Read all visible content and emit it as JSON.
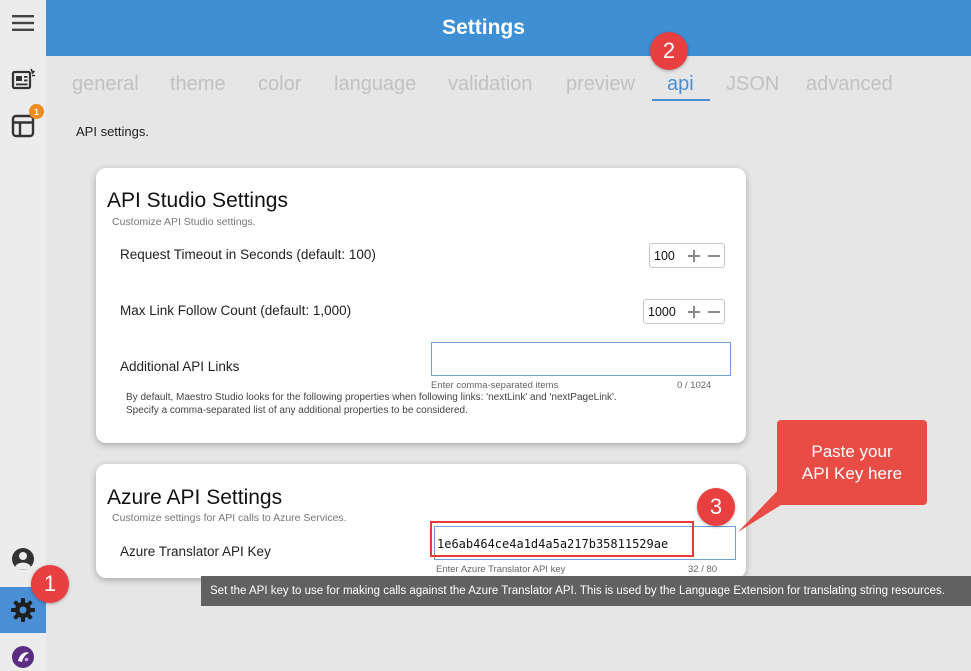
{
  "header": {
    "title": "Settings"
  },
  "rail": {
    "menu_icon": "hamburger-menu-icon",
    "news_icon": "news-icon",
    "panels_icon": "panels-icon",
    "panels_badge": "1",
    "account_icon": "account-icon",
    "settings_icon": "gear-icon",
    "logo_icon": "app-logo-icon",
    "accent_color": "#4a8fd6"
  },
  "tabs": [
    {
      "label": "general"
    },
    {
      "label": "theme"
    },
    {
      "label": "color"
    },
    {
      "label": "language"
    },
    {
      "label": "validation"
    },
    {
      "label": "preview"
    },
    {
      "label": "api"
    },
    {
      "label": "JSON"
    },
    {
      "label": "advanced"
    }
  ],
  "active_tab": "api",
  "intro": "API settings.",
  "api_studio": {
    "title": "API Studio Settings",
    "subtitle": "Customize API Studio settings.",
    "timeout": {
      "label": "Request Timeout in Seconds (default: 100)",
      "value": "100"
    },
    "max_link": {
      "label": "Max Link Follow Count (default: 1,000)",
      "value": "1000"
    },
    "additional_links": {
      "label": "Additional API Links",
      "value": "",
      "hint": "Enter comma-separated items",
      "counter": "0 / 1024",
      "help_line1": "By default, Maestro Studio looks for the following properties when following links: 'nextLink' and 'nextPageLink'.",
      "help_line2": "Specify a comma-separated list of any additional properties to be considered."
    }
  },
  "azure": {
    "title": "Azure API Settings",
    "subtitle": "Customize settings for API calls to Azure Services.",
    "translator_key": {
      "label": "Azure Translator API Key",
      "value": "1e6ab464ce4a1d4a5a217b35811529ae",
      "hint": "Enter Azure Translator API key",
      "counter": "32 / 80"
    }
  },
  "tooltip": "Set the API key to use for making calls against the Azure Translator API. This is used by the Language Extension for translating string resources.",
  "callouts": {
    "one": "1",
    "two": "2",
    "three": "3",
    "note_line1": "Paste your",
    "note_line2": "API Key here",
    "color": "#e84040"
  }
}
